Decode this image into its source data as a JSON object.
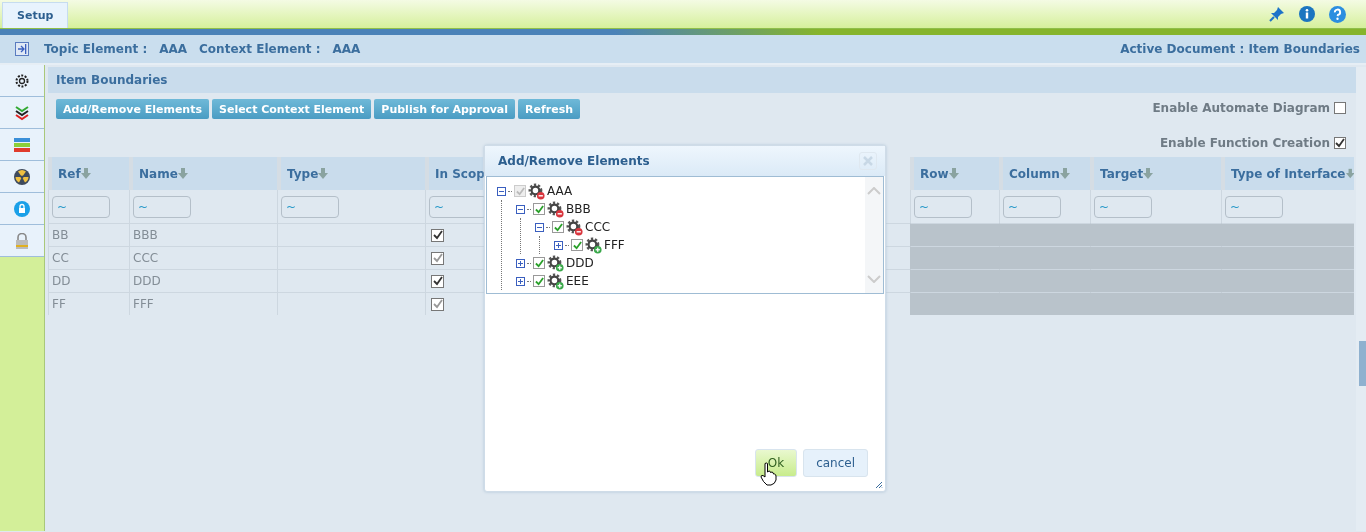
{
  "top_bar": {
    "tabs": [
      {
        "label": "Setup",
        "selected": true
      }
    ]
  },
  "header": {
    "topic_label": "Topic Element :",
    "topic_value": "AAA",
    "context_label": "Context Element :",
    "context_value": "AAA",
    "active_document": "Active Document : Item Boundaries"
  },
  "panel": {
    "title": "Item Boundaries",
    "buttons": [
      "Add/Remove Elements",
      "Select Context Element",
      "Publish for Approval",
      "Refresh"
    ],
    "options": [
      {
        "label": "Enable Automate Diagram",
        "checked": false
      },
      {
        "label": "Enable Function Creation",
        "checked": true
      }
    ]
  },
  "table": {
    "columns": [
      {
        "label": "Ref",
        "sort_icon": true
      },
      {
        "label": "Name",
        "sort_icon": true
      },
      {
        "label": "Type",
        "sort_icon": true
      },
      {
        "label": "In Scop",
        "sort_icon": false
      },
      {
        "label": "Row",
        "sort_icon": true
      },
      {
        "label": "Column",
        "sort_icon": true
      },
      {
        "label": "Target",
        "sort_icon": true
      },
      {
        "label": "Type of Interface",
        "sort_icon": true
      }
    ],
    "filters": [
      "~",
      "~",
      "~",
      "~",
      "~",
      "~",
      "~",
      "~"
    ],
    "rows": [
      {
        "ref": "BB",
        "name": "BBB",
        "in_scope": true,
        "disabled": false
      },
      {
        "ref": "CC",
        "name": "CCC",
        "in_scope": true,
        "disabled": true
      },
      {
        "ref": "DD",
        "name": "DDD",
        "in_scope": true,
        "disabled": false
      },
      {
        "ref": "FF",
        "name": "FFF",
        "in_scope": true,
        "disabled": true
      }
    ]
  },
  "dialog": {
    "title": "Add/Remove Elements",
    "tree": [
      {
        "label": "AAA",
        "checked": true,
        "disabled": true,
        "expanded": true,
        "kind": "minus",
        "children": [
          {
            "label": "BBB",
            "checked": true,
            "disabled": false,
            "expanded": true,
            "kind": "minus",
            "children": [
              {
                "label": "CCC",
                "checked": true,
                "disabled": false,
                "expanded": true,
                "kind": "minus",
                "children": [
                  {
                    "label": "FFF",
                    "checked": true,
                    "disabled": false,
                    "expanded": false,
                    "kind": "plus"
                  }
                ]
              }
            ]
          },
          {
            "label": "DDD",
            "checked": true,
            "disabled": false,
            "expanded": false,
            "kind": "plus"
          },
          {
            "label": "EEE",
            "checked": true,
            "disabled": false,
            "expanded": false,
            "kind": "plus"
          }
        ]
      }
    ],
    "buttons": [
      {
        "label": "Ok",
        "kind": "primary"
      },
      {
        "label": "cancel",
        "kind": "secondary"
      }
    ]
  }
}
